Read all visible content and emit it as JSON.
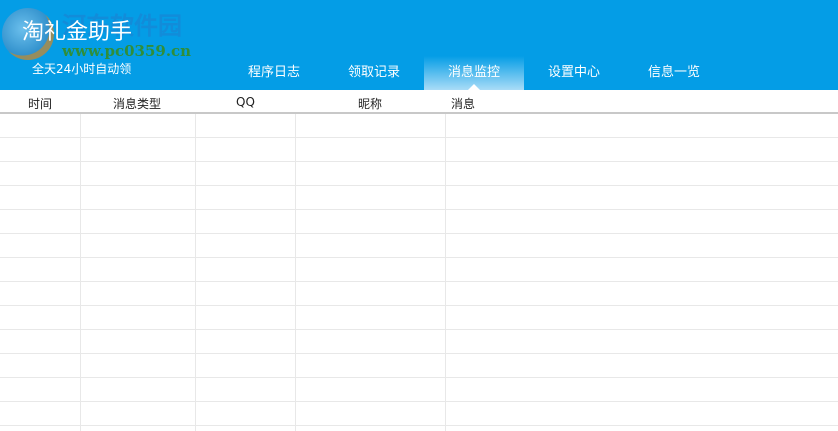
{
  "app": {
    "title": "淘礼金助手",
    "subtitle": "全天24小时自动领",
    "watermark": "河东软件园",
    "watermark_url": "www.pc0359.cn"
  },
  "tabs": [
    {
      "label": "程序日志"
    },
    {
      "label": "领取记录"
    },
    {
      "label": "消息监控",
      "active": true
    },
    {
      "label": "设置中心"
    },
    {
      "label": "信息一览"
    }
  ],
  "table": {
    "columns": [
      "时间",
      "消息类型",
      "QQ",
      "昵称",
      "消息"
    ],
    "rows": []
  }
}
